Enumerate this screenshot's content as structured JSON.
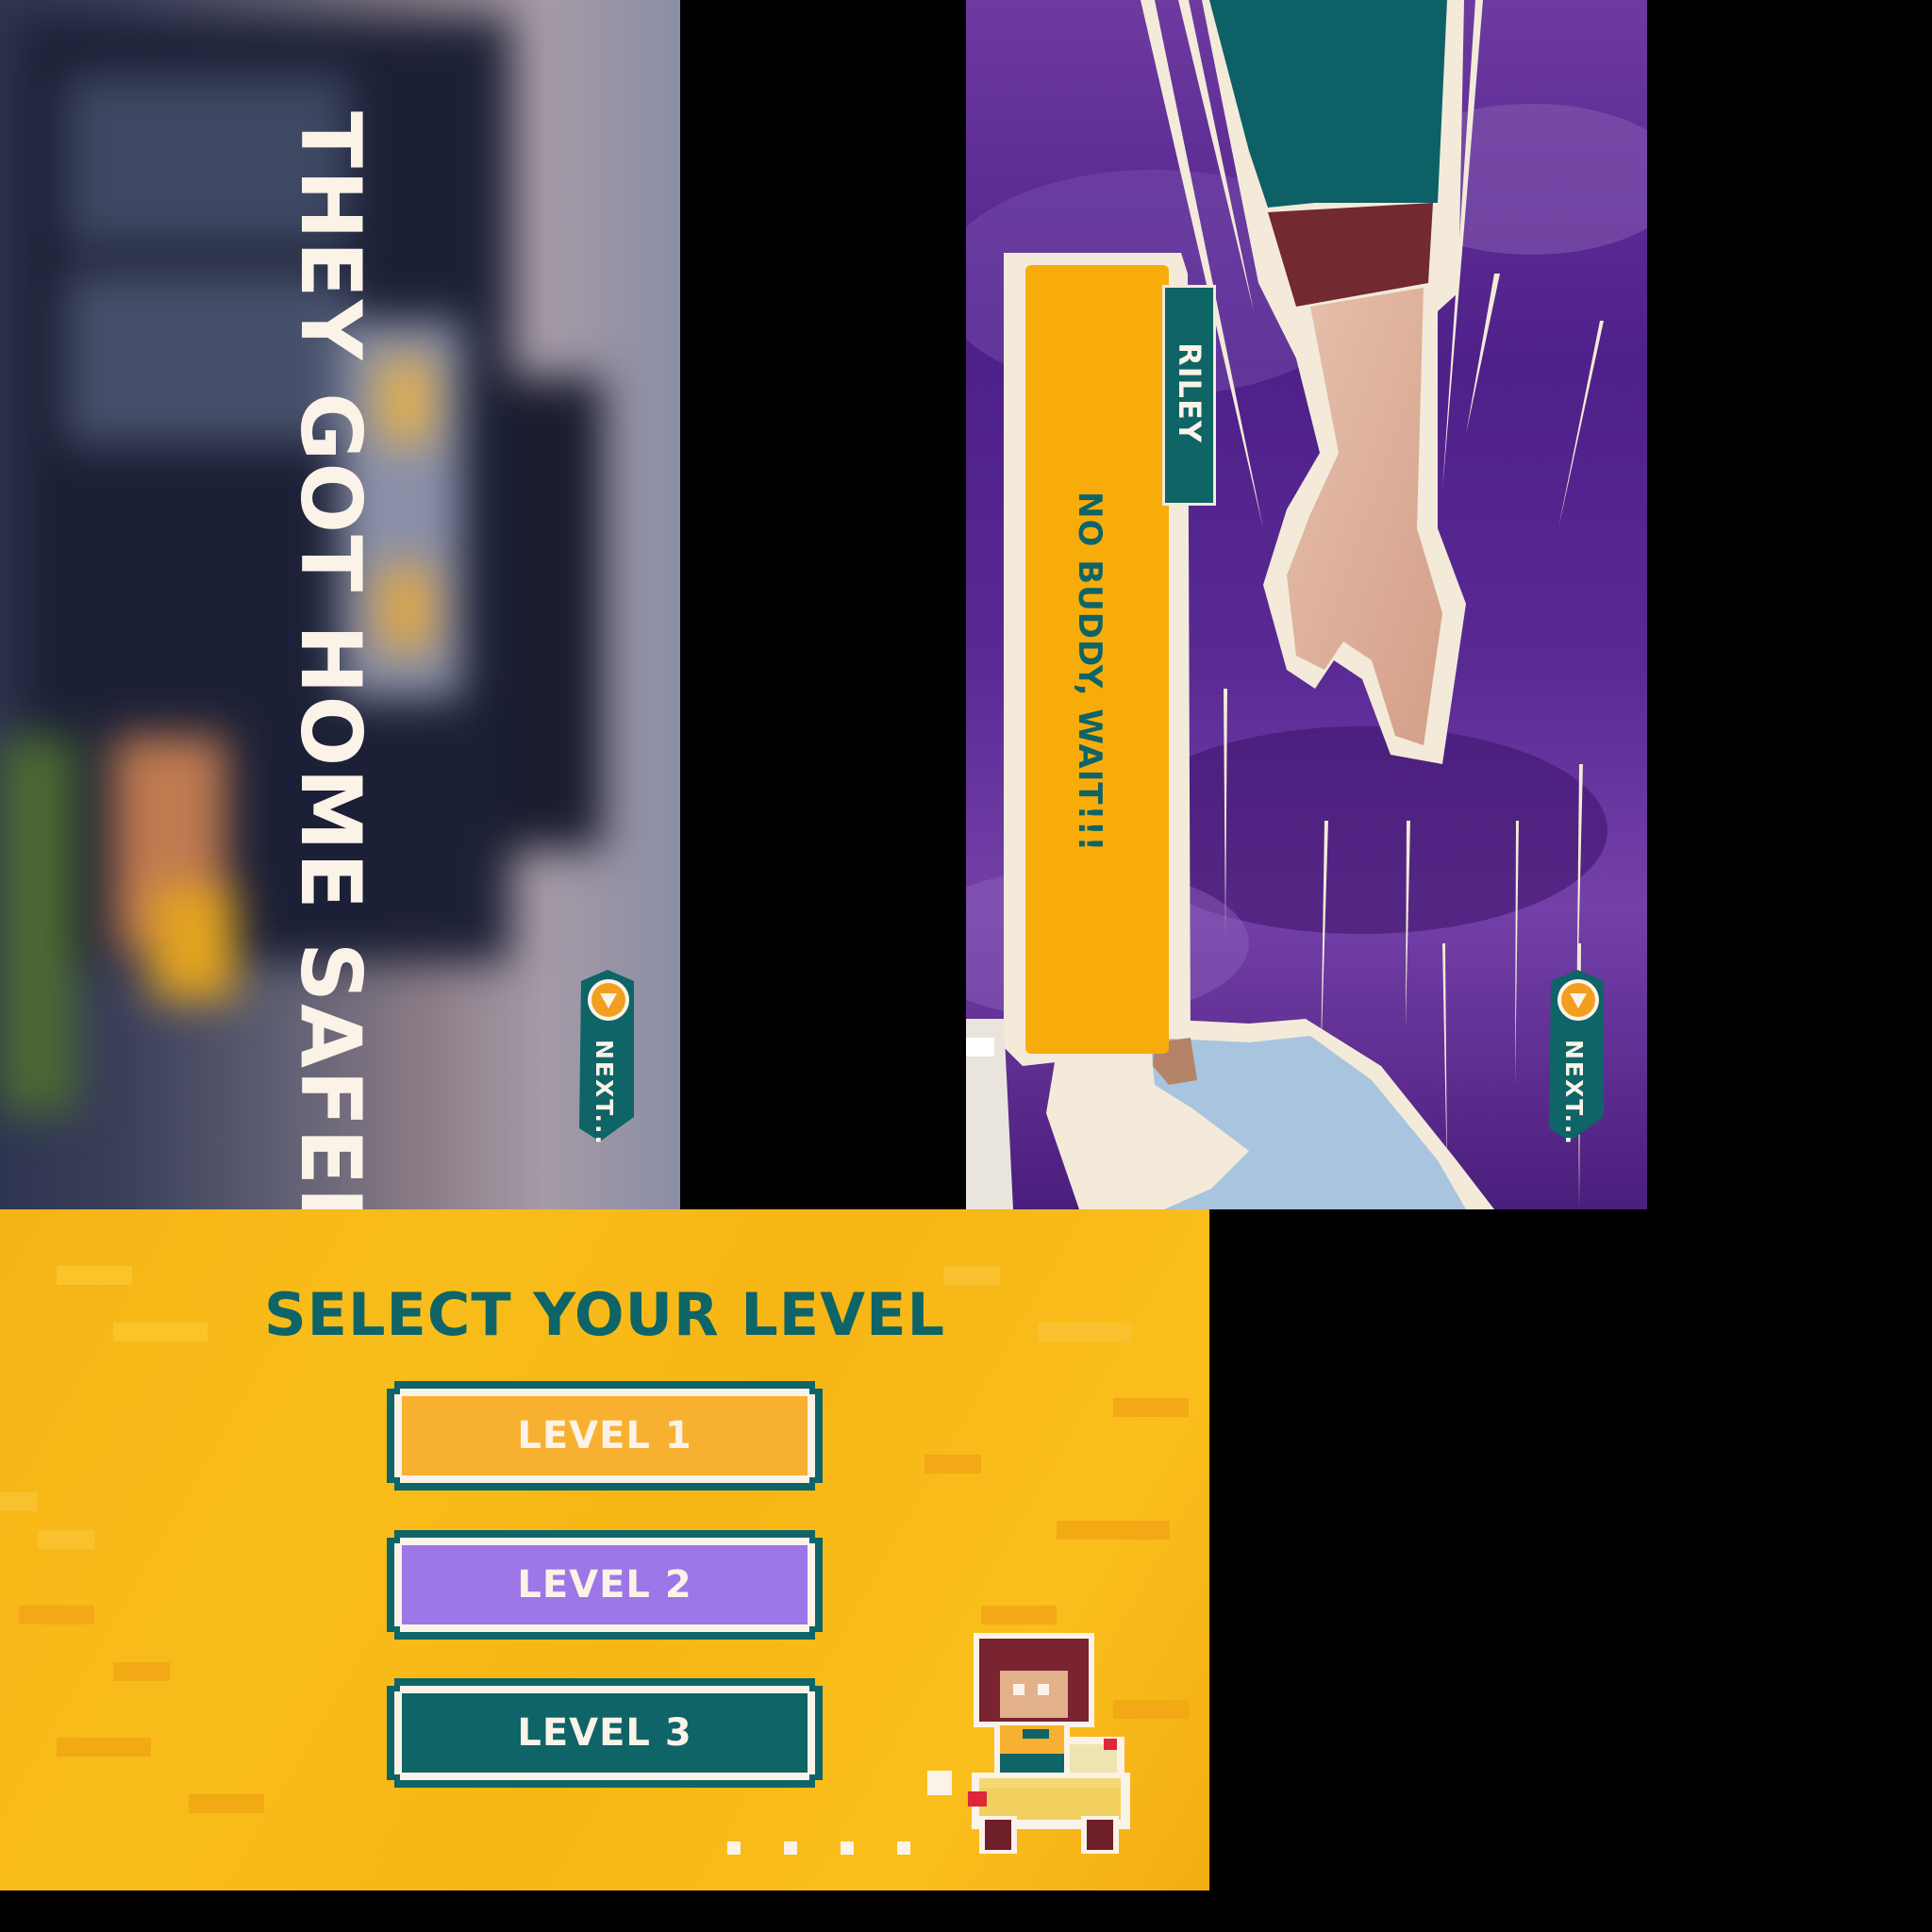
{
  "cutscene_home": {
    "caption": "THEY GOT HOME SAFELY",
    "next_label": "NEXT..."
  },
  "cutscene_dialog": {
    "speaker": "RILEY",
    "line": "NO BUDDY, WAIT!!!",
    "next_label": "NEXT..."
  },
  "level_select": {
    "title": "SELECT YOUR LEVEL",
    "levels": [
      {
        "label": "LEVEL 1",
        "color": "#f8b030"
      },
      {
        "label": "LEVEL 2",
        "color": "#9d76e8"
      },
      {
        "label": "LEVEL 3",
        "color": "#0e6467"
      }
    ]
  },
  "colors": {
    "teal": "#0e6467",
    "cream": "#fbf3e8",
    "yellow": "#f8ac0a",
    "purple_bg": "#5a2a94",
    "orange_accent": "#f29e1e"
  }
}
